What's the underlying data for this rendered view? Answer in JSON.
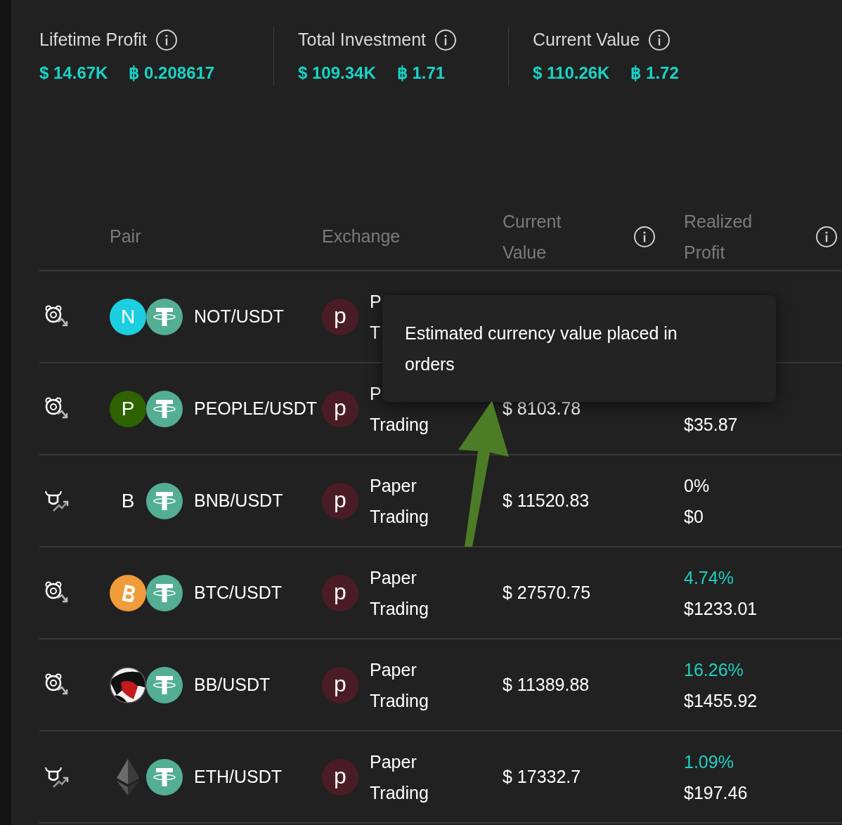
{
  "stats": [
    {
      "label": "Lifetime Profit",
      "usd": "$ 14.67K",
      "btc": "0.208617"
    },
    {
      "label": "Total Investment",
      "usd": "$ 109.34K",
      "btc": "1.71"
    },
    {
      "label": "Current Value",
      "usd": "$ 110.26K",
      "btc": "1.72"
    }
  ],
  "btc_symbol": "฿",
  "table": {
    "columns": [
      "Pair",
      "Exchange",
      "Current Value",
      "Realized Profit"
    ],
    "rows": [
      {
        "kind": "bear",
        "coin": {
          "kind": "letter",
          "letter": "N",
          "color": "#1ccfe0"
        },
        "pair": "NOT/USDT",
        "badge": "p",
        "exchange": [
          "P",
          "T"
        ]
      },
      {
        "kind": "bear",
        "coin": {
          "kind": "letter",
          "letter": "P",
          "color": "#2e6300"
        },
        "pair": "PEOPLE/USDT",
        "badge": "p",
        "exchange": [
          "P",
          "Trading"
        ],
        "value": "$ 8103.78",
        "amount": "$35.87"
      },
      {
        "kind": "bull",
        "coin": {
          "kind": "plain",
          "letter": "B"
        },
        "pair": "BNB/USDT",
        "badge": "p",
        "exchange": [
          "Paper",
          "Trading"
        ],
        "value": "$ 11520.83",
        "percent": "0%",
        "color": "#ffffff",
        "amount": "$0"
      },
      {
        "kind": "bear",
        "coin": {
          "kind": "bitcoin"
        },
        "pair": "BTC/USDT",
        "badge": "p",
        "exchange": [
          "Paper",
          "Trading"
        ],
        "value": "$ 27570.75",
        "percent": "4.74%",
        "color": "#1fd1c2",
        "amount": "$1233.01"
      },
      {
        "kind": "bear",
        "coin": {
          "kind": "picture"
        },
        "pair": "BB/USDT",
        "badge": "p",
        "exchange": [
          "Paper",
          "Trading"
        ],
        "value": "$ 11389.88",
        "percent": "16.26%",
        "color": "#1fd1c2",
        "amount": "$1455.92"
      },
      {
        "kind": "bull",
        "coin": {
          "kind": "ethereum"
        },
        "pair": "ETH/USDT",
        "badge": "p",
        "exchange": [
          "Paper",
          "Trading"
        ],
        "value": "$ 17332.7",
        "percent": "1.09%",
        "color": "#1fd1c2",
        "amount": "$197.46"
      }
    ]
  },
  "tooltip": "Estimated currency value placed in orders"
}
